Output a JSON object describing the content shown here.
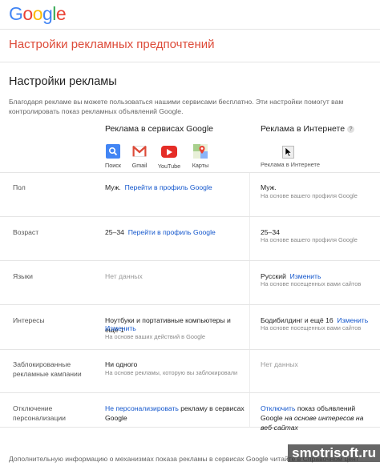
{
  "logo": "Google",
  "page_title": "Настройки рекламных предпочтений",
  "section_title": "Настройки рекламы",
  "description": "Благодаря рекламе вы можете пользоваться нашими сервисами бесплатно. Эти настройки помогут вам контролировать показ рекламных объявлений Google.",
  "columns": {
    "google": "Реклама в сервисах Google",
    "internet": "Реклама в Интернете",
    "help": "?"
  },
  "services": [
    {
      "label": "Поиск",
      "icon": "search-icon",
      "color": "#4285f4"
    },
    {
      "label": "Gmail",
      "icon": "gmail-icon",
      "color": "#dd4b39"
    },
    {
      "label": "YouTube",
      "icon": "youtube-icon",
      "color": "#e52d27"
    },
    {
      "label": "Карты",
      "icon": "maps-icon",
      "color": "#34a853"
    }
  ],
  "internet_label": "Реклама в Интернете",
  "rows": {
    "gender": {
      "label": "Пол",
      "g_value": "Муж.",
      "g_link": "Перейти в профиль Google",
      "i_value": "Муж.",
      "i_sub": "На основе вашего профиля Google"
    },
    "age": {
      "label": "Возраст",
      "g_value": "25–34",
      "g_link": "Перейти в профиль Google",
      "i_value": "25–34",
      "i_sub": "На основе вашего профиля Google"
    },
    "languages": {
      "label": "Языки",
      "g_value": "Нет данных",
      "i_value": "Русский",
      "i_link": "Изменить",
      "i_sub": "На основе посещенных вами сайтов"
    },
    "interests": {
      "label": "Интересы",
      "g_value": "Ноутбуки и портативные компьютеры и ещё 1",
      "g_link": "Изменить",
      "g_sub": "На основе ваших действий в Google",
      "i_value": "Бодибилдинг и ещё 16",
      "i_link": "Изменить",
      "i_sub": "На основе посещенных вами сайтов"
    },
    "blocked": {
      "label": "Заблокированные рекламные кампании",
      "g_value": "Ни одного",
      "g_sub": "На основе рекламы, которую вы заблокировали",
      "i_value": "Нет данных"
    },
    "optout": {
      "label": "Отключение персонализации",
      "g_link": "Не персонализировать",
      "g_text": "рекламу в сервисах Google",
      "i_link": "Отключить",
      "i_text": "показ объявлений Google",
      "i_italic": "на основе интересов на веб-сайтах"
    }
  },
  "footer": "Дополнительную информацию о механизмах показа рекламы в сервисах Google читайте в Справочном цент",
  "watermark": "smotrisoft.ru"
}
